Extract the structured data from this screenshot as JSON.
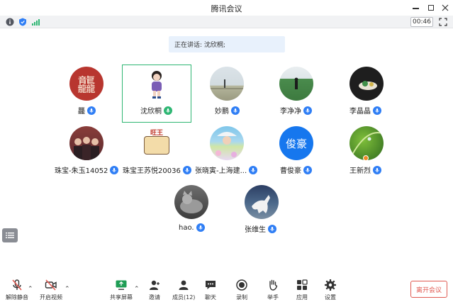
{
  "window": {
    "title": "腾讯会议"
  },
  "meeting": {
    "timer": "00:46",
    "speaking_label": "正在讲话: 沈欣桐;"
  },
  "participants": [
    {
      "name": "龘"
    },
    {
      "name": "沈欣桐"
    },
    {
      "name": "妙鹏"
    },
    {
      "name": "李净净"
    },
    {
      "name": "李晶晶"
    },
    {
      "name": "珠宝-朱玉14052"
    },
    {
      "name": "珠宝王苏悦20036"
    },
    {
      "name": "张晓寅-上海建..."
    },
    {
      "name": "曹俊豪"
    },
    {
      "name": "王新烈"
    },
    {
      "name": "hao."
    },
    {
      "name": "张维生"
    }
  ],
  "avatar_text": {
    "junhao": "俊豪",
    "red_seal": "龘",
    "sticker": "旺王"
  },
  "toolbar": {
    "unmute": "解除静音",
    "start_video": "开启视频",
    "share_screen": "共享屏幕",
    "invite": "邀请",
    "members": "成员(12)",
    "chat": "聊天",
    "record": "录制",
    "raise_hand": "举手",
    "apps": "应用",
    "settings": "设置",
    "end_meeting": "离开会议"
  },
  "colors": {
    "accent": "#2f7ef5",
    "active_border": "#2eb673",
    "end_red": "#e05a52"
  }
}
